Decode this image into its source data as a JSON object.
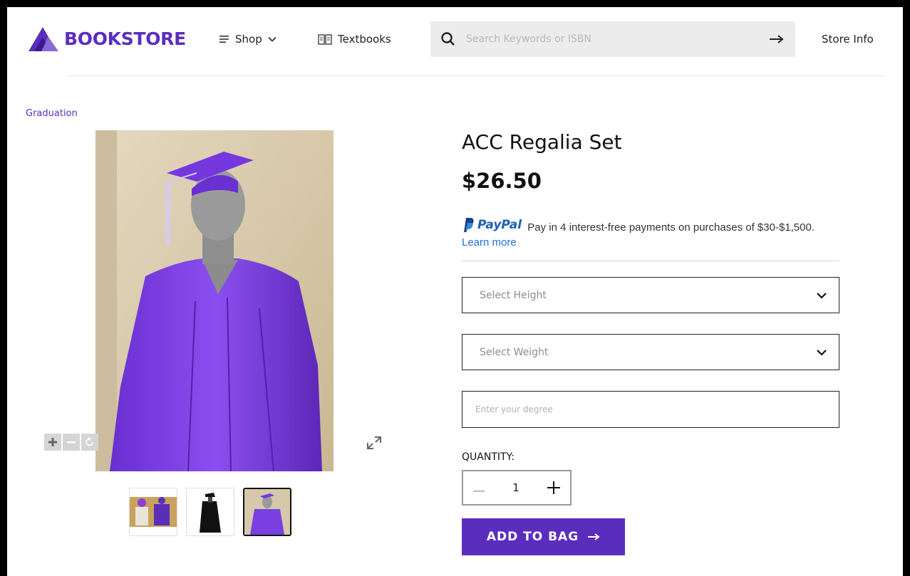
{
  "header": {
    "logo_text": "BOOKSTORE",
    "nav": {
      "shop_label": "Shop",
      "textbooks_label": "Textbooks",
      "store_info_label": "Store Info"
    },
    "search": {
      "placeholder": "Search Keywords or ISBN"
    }
  },
  "breadcrumb": {
    "label": "Graduation"
  },
  "product": {
    "title": "ACC Regalia Set",
    "price": "$26.50",
    "paypal": {
      "brand": "PayPal",
      "message": "Pay in 4 interest-free payments on purchases of $30-$1,500.",
      "learn_more": "Learn more"
    },
    "height_select": {
      "placeholder": "Select Height"
    },
    "weight_select": {
      "placeholder": "Select Weight"
    },
    "degree_input": {
      "placeholder": "Enter your degree"
    },
    "quantity": {
      "label": "QUANTITY:",
      "value": "1"
    },
    "add_to_bag_label": "ADD TO BAG"
  },
  "gallery": {
    "thumbnail_count": 3,
    "active_index": 2
  },
  "colors": {
    "brand_purple": "#5b2dbf",
    "gown_purple": "#7a3fe0",
    "link_blue": "#1e6fd6",
    "paypal_blue": "#1e5fb3"
  },
  "icons": {
    "logo": "bookstore-logo-icon",
    "shop": "menu-lines-icon",
    "shop_dropdown": "chevron-down-icon",
    "textbooks": "open-book-icon",
    "search": "search-icon",
    "search_submit": "arrow-right-icon",
    "zoom_in": "plus-icon",
    "zoom_out": "minus-icon",
    "reset": "rotate-icon",
    "fullscreen": "expand-icon",
    "select_dropdown": "chevron-down-icon",
    "add_to_bag": "arrow-right-icon"
  }
}
